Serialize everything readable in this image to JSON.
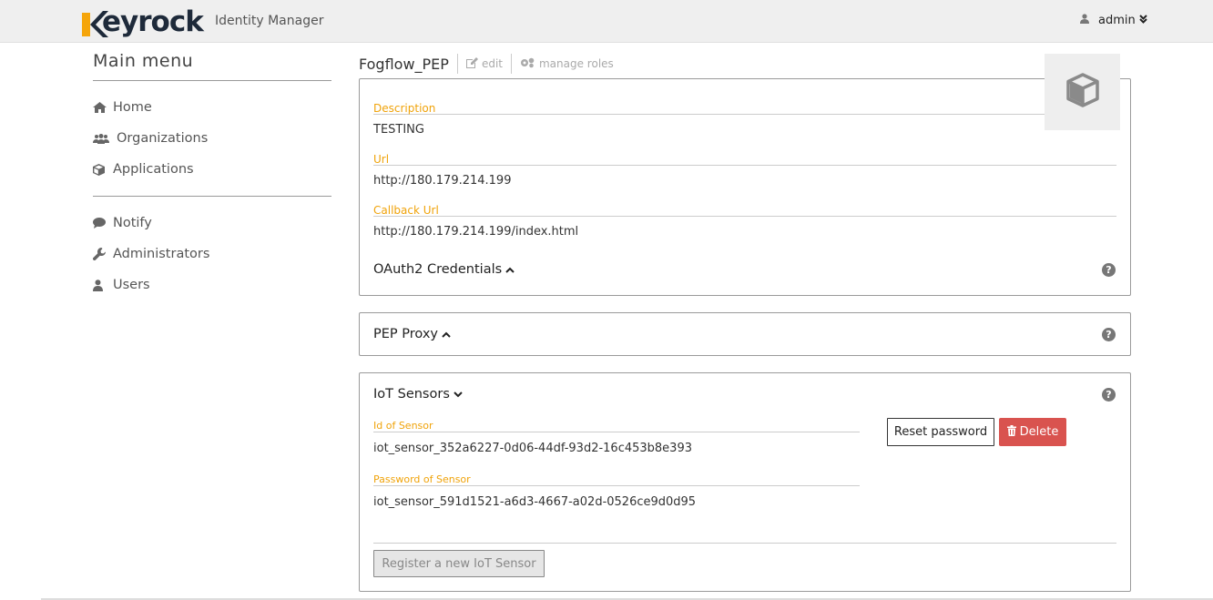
{
  "header": {
    "logo_text": "eyrock",
    "subtitle": "Identity Manager",
    "user": "admin"
  },
  "sidebar": {
    "title": "Main menu",
    "group1": [
      {
        "label": "Home",
        "icon": "home-icon"
      },
      {
        "label": "Organizations",
        "icon": "users-icon"
      },
      {
        "label": "Applications",
        "icon": "cube-icon"
      }
    ],
    "group2": [
      {
        "label": "Notify",
        "icon": "comment-icon"
      },
      {
        "label": "Administrators",
        "icon": "wrench-icon"
      },
      {
        "label": "Users",
        "icon": "user-icon"
      }
    ]
  },
  "app": {
    "name": "Fogflow_PEP",
    "edit_label": "edit",
    "manage_roles_label": "manage roles"
  },
  "details": {
    "description_label": "Description",
    "description_value": "TESTING",
    "url_label": "Url",
    "url_value": "http://180.179.214.199",
    "callback_label": "Callback Url",
    "callback_value": "http://180.179.214.199/index.html",
    "oauth_title": "OAuth2 Credentials"
  },
  "pep": {
    "title": "PEP Proxy"
  },
  "iot": {
    "title": "IoT Sensors",
    "id_label": "Id of Sensor",
    "id_value": "iot_sensor_352a6227-0d06-44df-93d2-16c453b8e393",
    "pw_label": "Password of Sensor",
    "pw_value": "iot_sensor_591d1521-a6d3-4667-a02d-0526ce9d0d95",
    "reset_label": "Reset password",
    "delete_label": "Delete",
    "register_label": "Register a new IoT Sensor"
  },
  "help_glyph": "?",
  "colors": {
    "label_accent": "#f0a30a",
    "delete": "#d9534f",
    "logo_orange": "#f5a50a"
  }
}
